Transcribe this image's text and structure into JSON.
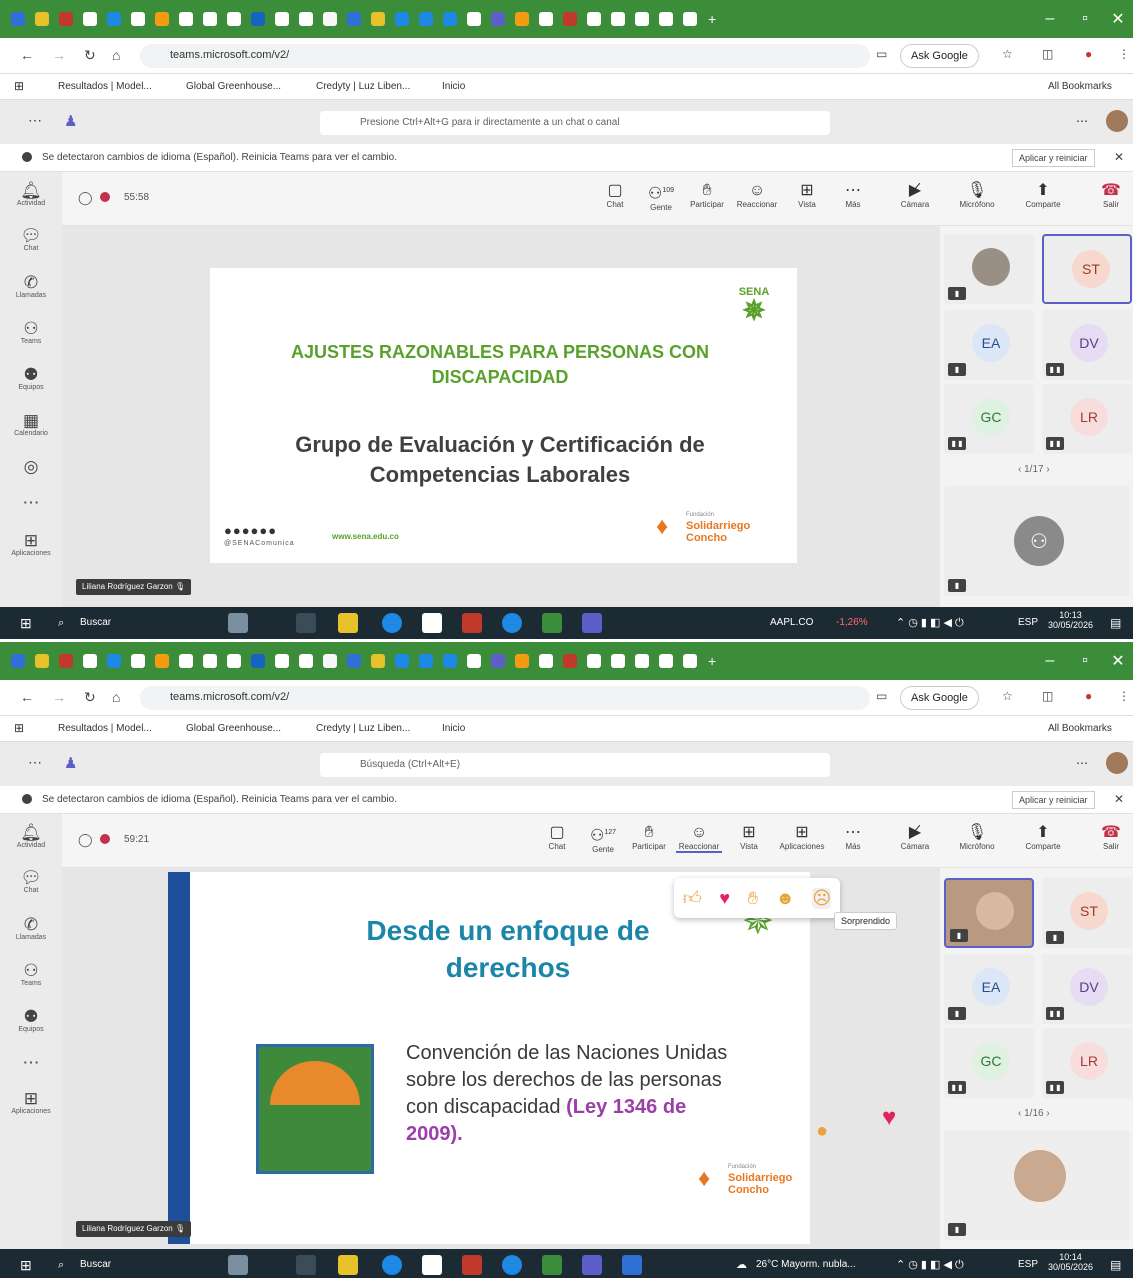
{
  "browser": {
    "url": "teams.microsoft.com/v2/",
    "ask_google": "Ask Google",
    "all_bookmarks": "All Bookmarks",
    "bookmarks": [
      "Resultados | Model...",
      "Global Greenhouse...",
      "Credyty | Luz Liben...",
      "Inicio"
    ]
  },
  "notice": {
    "text": "Se detectaron cambios de idioma (Español). Reinicia Teams para ver el cambio.",
    "action": "Aplicar y reiniciar"
  },
  "rail": [
    "Actividad",
    "Chat",
    "Llamadas",
    "Teams",
    "Equipos",
    "Calendario",
    "Aplicaciones"
  ],
  "screens": [
    {
      "search_placeholder": "Presione Ctrl+Alt+G para ir directamente a un chat o canal",
      "timer": "55:58",
      "toolbar": {
        "chat": "Chat",
        "people": "Gente",
        "people_count": "109",
        "raise": "Participar",
        "react": "Reaccionar",
        "view": "Vista",
        "more": "Más",
        "camera": "Cámara",
        "mic": "Micrófono",
        "share": "Comparte",
        "leave": "Salir"
      },
      "slide": {
        "title": "AJUSTES RAZONABLES PARA PERSONAS CON DISCAPACIDAD",
        "subtitle": "Grupo de Evaluación y Certificación de Competencias Laborales",
        "sena": "SENA",
        "handle": "@SENAComunica",
        "web": "www.sena.edu.co",
        "foundation_small": "Fundación",
        "foundation": "Solidarriego Concho"
      },
      "presenter": "Liliana Rodríguez Garzon",
      "tiles": [
        "ST",
        "EA",
        "DV",
        "GC",
        "LR"
      ],
      "pager": "1/17",
      "taskbar": {
        "search": "Buscar",
        "ticker": "AAPL.CO",
        "change": "-1,26%",
        "lang": "ESP",
        "time": "10:13",
        "date": "30/05/2026"
      }
    },
    {
      "search_placeholder": "Búsqueda (Ctrl+Alt+E)",
      "timer": "59:21",
      "toolbar": {
        "chat": "Chat",
        "people": "Gente",
        "people_count": "127",
        "raise": "Participar",
        "react": "Reaccionar",
        "view": "Vista",
        "apps": "Aplicaciones",
        "more": "Más",
        "camera": "Cámara",
        "mic": "Micrófono",
        "share": "Comparte",
        "leave": "Salir"
      },
      "reactions_tooltip": "Sorprendido",
      "slide": {
        "title": "Desde un enfoque de derechos",
        "body": "Convención de las Naciones Unidas sobre los derechos de las personas con discapacidad",
        "law": "(Ley 1346 de 2009).",
        "foundation_small": "Fundación",
        "foundation": "Solidarriego Concho"
      },
      "presenter": "Liliana Rodríguez Garzon",
      "tiles": [
        "ST",
        "EA",
        "DV",
        "GC",
        "LR"
      ],
      "pager": "1/16",
      "taskbar": {
        "search": "Buscar",
        "weather": "26°C Mayorm. nubla...",
        "lang": "ESP",
        "time": "10:14",
        "date": "30/05/2026"
      }
    }
  ],
  "colors": {
    "chrome_green": "#3c8d3a",
    "slide_green": "#5aa02c",
    "slide_blue": "#1b86a8",
    "slide_magenta": "#9b3fa8",
    "teams_purple": "#5b5fc7",
    "leave_red": "#c4314b"
  }
}
